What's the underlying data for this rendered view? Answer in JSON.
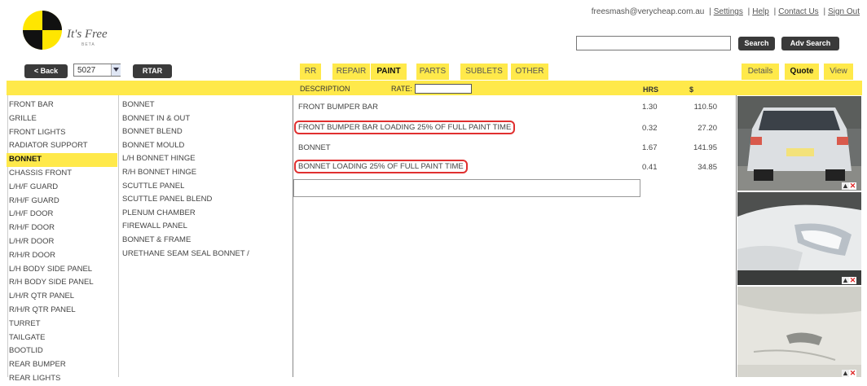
{
  "brand": {
    "tagline": "It's Free",
    "beta": "BETA"
  },
  "top_bar": {
    "email": "freesmash@verycheap.com.au",
    "links": [
      "Settings",
      "Help",
      "Contact Us",
      "Sign Out"
    ]
  },
  "search": {
    "value": "",
    "search_label": "Search",
    "advanced_label": "Adv Search"
  },
  "toolbar": {
    "back_label": "< Back",
    "job_number": "5027",
    "rtar_label": "RTAR"
  },
  "tabs": [
    {
      "label": "RR",
      "active": false
    },
    {
      "label": "REPAIR",
      "active": false
    },
    {
      "label": "PAINT",
      "active": true
    },
    {
      "label": "PARTS",
      "active": false
    },
    {
      "label": "SUBLETS",
      "active": false
    },
    {
      "label": "OTHER",
      "active": false
    }
  ],
  "view_tabs": [
    {
      "label": "Details",
      "active": false
    },
    {
      "label": "Quote",
      "active": true
    },
    {
      "label": "View",
      "active": false
    }
  ],
  "quote_header": {
    "description": "DESCRIPTION",
    "rate": "RATE:",
    "rate_value": "",
    "hrs": "HRS",
    "dollar": "$"
  },
  "sections": [
    "FRONT BAR",
    "GRILLE",
    "FRONT LIGHTS",
    "RADIATOR SUPPORT",
    "BONNET",
    "CHASSIS FRONT",
    "L/H/F GUARD",
    "R/H/F GUARD",
    "L/H/F DOOR",
    "R/H/F DOOR",
    "L/H/R DOOR",
    "R/H/R DOOR",
    "L/H BODY SIDE PANEL",
    "R/H BODY SIDE PANEL",
    "L/H/R QTR PANEL",
    "R/H/R QTR PANEL",
    "TURRET",
    "TAILGATE",
    "BOOTLID",
    "REAR BUMPER",
    "REAR LIGHTS"
  ],
  "selected_section": "BONNET",
  "parts": [
    "BONNET",
    "BONNET IN & OUT",
    "BONNET BLEND",
    "BONNET MOULD",
    "L/H BONNET HINGE",
    "R/H BONNET HINGE",
    "SCUTTLE PANEL",
    "SCUTTLE PANEL BLEND",
    "PLENUM CHAMBER",
    "FIREWALL PANEL",
    "BONNET & FRAME",
    "URETHANE SEAM SEAL BONNET /"
  ],
  "quote_lines": [
    {
      "description": "FRONT BUMPER BAR",
      "hrs": "1.30",
      "amount": "110.50",
      "highlighted": false
    },
    {
      "description": "FRONT BUMPER BAR LOADING 25% OF FULL PAINT TIME",
      "hrs": "0.32",
      "amount": "27.20",
      "highlighted": true
    },
    {
      "description": "BONNET",
      "hrs": "1.67",
      "amount": "141.95",
      "highlighted": false
    },
    {
      "description": "BONNET LOADING 25% OF FULL PAINT TIME",
      "hrs": "0.41",
      "amount": "34.85",
      "highlighted": true
    }
  ],
  "colors": {
    "accent": "#ffe94a",
    "dark_button": "#3a3a3a",
    "highlight_ring": "#e03030"
  },
  "photos": [
    "photo-rear-wagon",
    "photo-front-headlight",
    "photo-door-damage"
  ]
}
